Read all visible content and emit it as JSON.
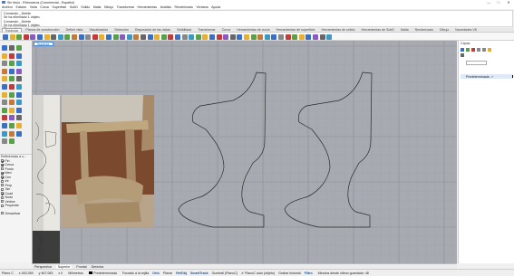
{
  "window": {
    "title": "Sin título - Rhinoceros (Commercial - Español)",
    "controls": [
      "—",
      "□",
      "✕"
    ]
  },
  "menu": [
    "Archivo",
    "Edición",
    "Vista",
    "Curva",
    "Superficie",
    "SubD",
    "Sólido",
    "Malla",
    "Dibujo",
    "Transformar",
    "Herramientas",
    "Análisis",
    "Renderizado",
    "Ventana",
    "Ayuda"
  ],
  "command_history": {
    "lines": [
      "Comando: _Delete",
      "Se ha eliminado 1 objeto.",
      "Comando: _Delete",
      "Se ha eliminado 1 objeto."
    ],
    "prompt": "Comando:"
  },
  "toolbar_tabs": [
    "Estándar",
    "Planos de construcción",
    "Definir vista",
    "Visualización",
    "Selección",
    "Disposición de las vistas",
    "Visibilidad",
    "Transformar",
    "Curva",
    "Herramientas de curva",
    "Herramientas de superficie",
    "Herramientas de sólido",
    "Herramientas de SubD",
    "Malla",
    "Renderizado",
    "Dibujo",
    "Novedades V8"
  ],
  "toolbar_colors": [
    "#3a6fc4",
    "#e8b030",
    "#5aa04a",
    "#c43a3a",
    "#8a5ac4",
    "#3a6fc4",
    "#e8b030",
    "#666666",
    "#3a9ac4",
    "#5aa04a",
    "#c47a3a",
    "#3a6fc4",
    "#888888",
    "#c43a3a",
    "#e8b030",
    "#3a6fc4",
    "#5aa04a",
    "#8a5ac4",
    "#3a9ac4",
    "#c47a3a",
    "#666666",
    "#3a6fc4",
    "#e8b030",
    "#5aa04a",
    "#c43a3a",
    "#3a6fc4",
    "#888888",
    "#3a9ac4",
    "#5aa04a",
    "#e8b030",
    "#3a6fc4",
    "#c43a3a",
    "#8a5ac4",
    "#666666",
    "#3a6fc4",
    "#e8b030",
    "#5aa04a",
    "#c47a3a",
    "#3a9ac4",
    "#3a6fc4",
    "#888888",
    "#c43a3a",
    "#5aa04a",
    "#e8b030",
    "#3a6fc4",
    "#8a5ac4",
    "#666666",
    "#3a9ac4"
  ],
  "left_tool_colors": [
    "#3a6fc4",
    "#666666",
    "#5aa04a",
    "#e8b030",
    "#c43a3a",
    "#3a6fc4",
    "#888888",
    "#5aa04a",
    "#3a9ac4",
    "#c47a3a",
    "#3a6fc4",
    "#8a5ac4",
    "#e8b030",
    "#5aa04a",
    "#666666",
    "#3a6fc4",
    "#c43a3a",
    "#3a9ac4",
    "#e8b030",
    "#5aa04a",
    "#3a6fc4",
    "#888888",
    "#c47a3a",
    "#3a9ac4",
    "#5aa04a",
    "#e8b030",
    "#3a6fc4",
    "#c43a3a",
    "#8a5ac4",
    "#666666",
    "#3a6fc4",
    "#5aa04a",
    "#e8b030",
    "#3a9ac4",
    "#c47a3a",
    "#3a6fc4",
    "#888888",
    "#5aa04a"
  ],
  "osnap": {
    "title": "Referencias a o...",
    "items": [
      {
        "label": "Fin",
        "checked": true
      },
      {
        "label": "Cerca",
        "checked": true
      },
      {
        "label": "Punto",
        "checked": false
      },
      {
        "label": "Med",
        "checked": true
      },
      {
        "label": "Cen",
        "checked": true
      },
      {
        "label": "Int",
        "checked": false
      },
      {
        "label": "Perp",
        "checked": false
      },
      {
        "label": "Tan",
        "checked": false
      },
      {
        "label": "Cuad",
        "checked": true
      },
      {
        "label": "Nodo",
        "checked": false
      },
      {
        "label": "Vértice",
        "checked": false
      },
      {
        "label": "Proyectar",
        "checked": false
      }
    ],
    "disable_label": "Desactivar",
    "disable_checked": false
  },
  "viewport": {
    "tab_label": "Superior",
    "background": "#a7abb1",
    "curve_color": "#2a2a2a"
  },
  "view_tabs": [
    "Perspectiva",
    "Superior",
    "Frontal",
    "Derecha"
  ],
  "status_bar": {
    "cplane": "Plano C",
    "x": "x 453.359",
    "y": "y 467.083",
    "z": "z 0",
    "units": "Milímetros",
    "layer_name": "Predeterminada",
    "toggles": [
      {
        "label": "Forzado a la rejilla",
        "bold": false
      },
      {
        "label": "Orto",
        "bold": true
      },
      {
        "label": "Planar",
        "bold": false
      },
      {
        "label": "RefObj",
        "bold": true
      },
      {
        "label": "SmartTrack",
        "bold": true
      },
      {
        "label": "Gumball (PlanoC)",
        "bold": false
      },
      {
        "label": "✔ PlanoC auto (objeto)",
        "bold": false
      },
      {
        "label": "Grabar historial",
        "bold": false
      },
      {
        "label": "Filtro",
        "bold": true
      }
    ],
    "message": "Minutos desde último guardado: 48"
  },
  "right_panel": {
    "title": "Capas",
    "search_placeholder": "",
    "layers": [
      {
        "name": "Predeterminada",
        "current": true,
        "color": "#000000"
      }
    ]
  }
}
